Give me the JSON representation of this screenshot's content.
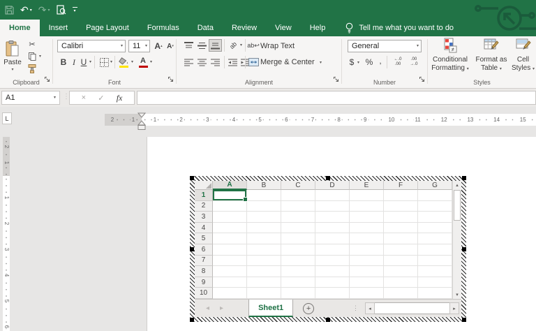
{
  "colors": {
    "excel_green": "#217346",
    "watermark_green": "#195734",
    "fill_color_swatch": "#ffe400",
    "font_color_swatch": "#c00000"
  },
  "ribbon_tabs": {
    "items": [
      {
        "label": "Home",
        "active": true
      },
      {
        "label": "Insert",
        "active": false
      },
      {
        "label": "Page Layout",
        "active": false
      },
      {
        "label": "Formulas",
        "active": false
      },
      {
        "label": "Data",
        "active": false
      },
      {
        "label": "Review",
        "active": false
      },
      {
        "label": "View",
        "active": false
      },
      {
        "label": "Help",
        "active": false
      }
    ],
    "tell_me": "Tell me what you want to do"
  },
  "ribbon": {
    "clipboard": {
      "group_label": "Clipboard",
      "paste_label": "Paste"
    },
    "font": {
      "group_label": "Font",
      "font_name": "Calibri",
      "font_size": "11",
      "bold": "B",
      "italic": "I",
      "underline": "U",
      "grow_shrink_letter": "A",
      "font_color_letter": "A"
    },
    "alignment": {
      "group_label": "Alignment",
      "wrap_text_label": "Wrap Text",
      "merge_center_label": "Merge & Center"
    },
    "number": {
      "group_label": "Number",
      "number_format": "General",
      "currency": "$",
      "percent": "%",
      "comma": ",",
      "increase_decimal_top": "←.0",
      "increase_decimal_bottom": ".00",
      "decrease_decimal_top": ".00",
      "decrease_decimal_bottom": "→.0"
    },
    "styles": {
      "group_label": "Styles",
      "conditional_line1": "Conditional",
      "conditional_line2": "Formatting",
      "format_table_line1": "Format as",
      "format_table_line2": "Table",
      "cell_styles_line1": "Cell",
      "cell_styles_line2": "Styles"
    }
  },
  "formula_bar": {
    "name_box": "A1",
    "insert_function": "fx",
    "formula_value": ""
  },
  "rulers": {
    "tab_selector": "L",
    "horizontal_margin_numbers": [
      "2",
      "1"
    ],
    "horizontal_numbers": [
      "1",
      "2",
      "3",
      "4",
      "5",
      "6",
      "7",
      "8",
      "9",
      "10",
      "11",
      "12",
      "13",
      "14",
      "15"
    ],
    "vertical_margin_numbers": [
      "2",
      "1"
    ],
    "vertical_numbers": [
      "1",
      "2",
      "3",
      "4",
      "5",
      "6"
    ]
  },
  "worksheet": {
    "columns": [
      "A",
      "B",
      "C",
      "D",
      "E",
      "F",
      "G"
    ],
    "rows": [
      "1",
      "2",
      "3",
      "4",
      "5",
      "6",
      "7",
      "8",
      "9",
      "10"
    ],
    "selected": {
      "col": "A",
      "row": "1"
    },
    "sheet_tabs": [
      {
        "label": "Sheet1",
        "active": true
      }
    ]
  },
  "icons": {
    "caret_down": "▾",
    "undo": "↶",
    "redo": "↷",
    "cut": "✂",
    "orientation_text": "ab",
    "wrap_text_glyph": "ab↩",
    "cancel": "×",
    "enter": "✓",
    "dots_separator": "⋮",
    "nav_left_arrow": "◂",
    "nav_right_arrow": "▸",
    "scroll_up": "▴",
    "scroll_down": "▾",
    "add_sheet": "+",
    "not_equal": "≠"
  }
}
